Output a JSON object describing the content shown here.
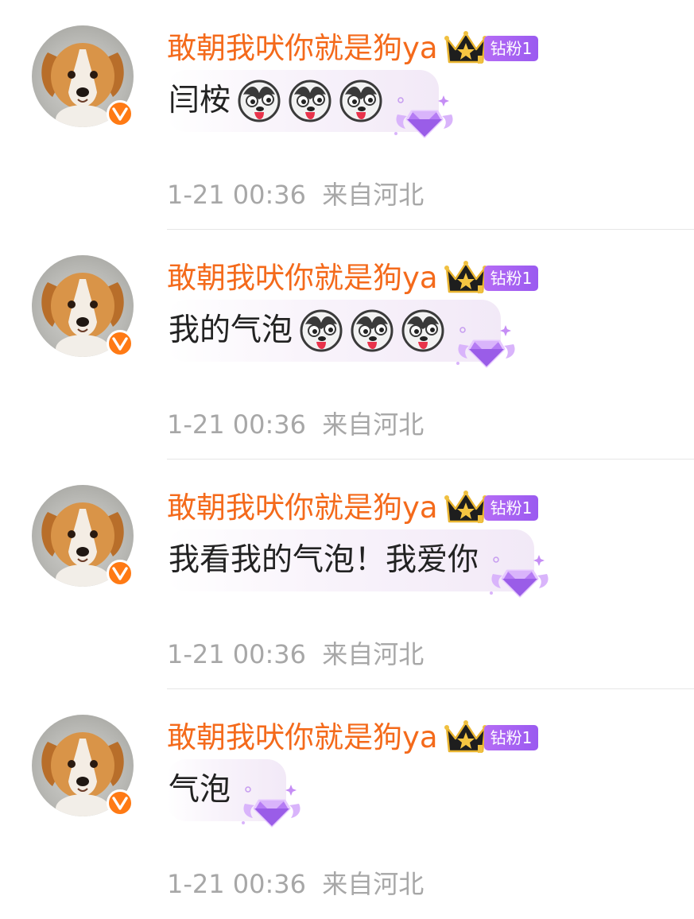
{
  "colors": {
    "username": "#f46a1b",
    "verified": "#ff7a14",
    "fan_badge": "#a862f2",
    "meta": "#a7a7a7"
  },
  "comments": [
    {
      "username": "敢朝我吠你就是狗ya",
      "badge": "钻粉1",
      "text": "闫桉",
      "emoji_count": 3,
      "emoji_icon": "husky-dog-emoji",
      "time": "1-21 00:36",
      "location": "来自河北"
    },
    {
      "username": "敢朝我吠你就是狗ya",
      "badge": "钻粉1",
      "text": "我的气泡",
      "emoji_count": 3,
      "emoji_icon": "husky-dog-emoji",
      "time": "1-21 00:36",
      "location": "来自河北"
    },
    {
      "username": "敢朝我吠你就是狗ya",
      "badge": "钻粉1",
      "text": "我看我的气泡！我爱你",
      "emoji_count": 0,
      "emoji_icon": "husky-dog-emoji",
      "time": "1-21 00:36",
      "location": "来自河北"
    },
    {
      "username": "敢朝我吠你就是狗ya",
      "badge": "钻粉1",
      "text": "气泡",
      "emoji_count": 0,
      "emoji_icon": "husky-dog-emoji",
      "time": "1-21 00:36",
      "location": "来自河北"
    }
  ]
}
